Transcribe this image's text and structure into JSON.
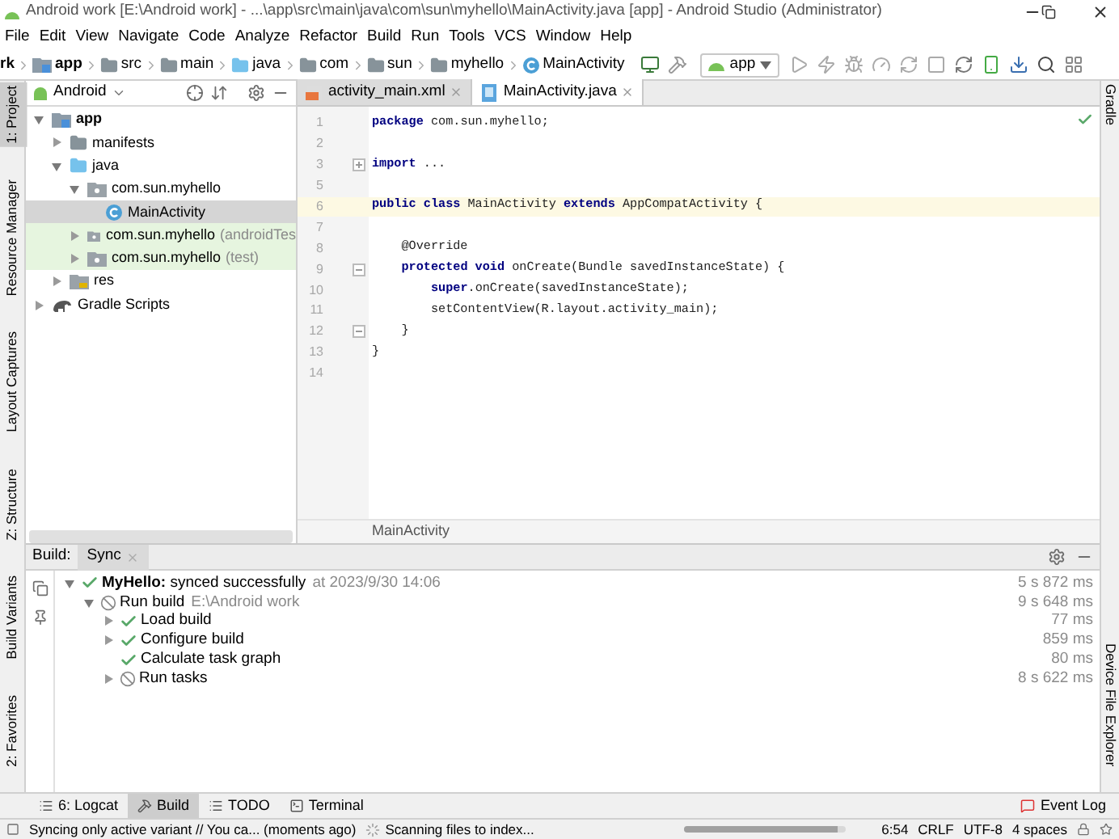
{
  "window": {
    "title": "Android work [E:\\Android work] - ...\\app\\src\\main\\java\\com\\sun\\myhello\\MainActivity.java [app] - Android Studio (Administrator)"
  },
  "menu": [
    "File",
    "Edit",
    "View",
    "Navigate",
    "Code",
    "Analyze",
    "Refactor",
    "Build",
    "Run",
    "Tools",
    "VCS",
    "Window",
    "Help"
  ],
  "breadcrumbs": [
    {
      "label": "rk",
      "kind": "text"
    },
    {
      "label": "app",
      "kind": "module"
    },
    {
      "label": "src",
      "kind": "folder"
    },
    {
      "label": "main",
      "kind": "folder"
    },
    {
      "label": "java",
      "kind": "source"
    },
    {
      "label": "com",
      "kind": "folder"
    },
    {
      "label": "sun",
      "kind": "folder"
    },
    {
      "label": "myhello",
      "kind": "folder"
    },
    {
      "label": "MainActivity",
      "kind": "class"
    }
  ],
  "run_config": "app",
  "left_tools": [
    {
      "label": "1: Project",
      "selected": true
    },
    {
      "label": "Resource Manager",
      "selected": false
    },
    {
      "label": "Layout Captures",
      "selected": false
    },
    {
      "label": "Z: Structure",
      "selected": false
    },
    {
      "label": "Build Variants",
      "selected": false
    },
    {
      "label": "2: Favorites",
      "selected": false
    }
  ],
  "right_tools": [
    "Gradle",
    "Device File Explorer"
  ],
  "project": {
    "view": "Android",
    "tree": [
      {
        "label": "app",
        "kind": "module",
        "expanded": true,
        "children": [
          {
            "label": "manifests",
            "kind": "folder",
            "expanded": false
          },
          {
            "label": "java",
            "kind": "source",
            "expanded": true,
            "children": [
              {
                "label": "com.sun.myhello",
                "kind": "package",
                "expanded": true,
                "children": [
                  {
                    "label": "MainActivity",
                    "kind": "class",
                    "selected": true
                  }
                ]
              },
              {
                "label": "com.sun.myhello",
                "suffix": "(androidTes",
                "kind": "package",
                "expanded": false,
                "test": true
              },
              {
                "label": "com.sun.myhello",
                "suffix": "(test)",
                "kind": "package",
                "expanded": false,
                "test": true
              }
            ]
          },
          {
            "label": "res",
            "kind": "res",
            "expanded": false
          }
        ]
      },
      {
        "label": "Gradle Scripts",
        "kind": "gradle",
        "expanded": false
      }
    ]
  },
  "editor": {
    "tabs": [
      {
        "label": "activity_main.xml",
        "kind": "xml",
        "selected": false
      },
      {
        "label": "MainActivity.java",
        "kind": "java",
        "selected": true
      }
    ],
    "lines": [
      {
        "number": "1",
        "text": "**package** com.sun.myhello;",
        "current": false
      },
      {
        "number": "2",
        "current": false
      },
      {
        "number": "3",
        "text": "**import** ...",
        "current": false,
        "folded": true
      },
      {
        "number": "5",
        "current": false
      },
      {
        "number": "6",
        "text": "**public class** MainActivity **extends** AppCompatActivity {",
        "current": true
      },
      {
        "number": "7",
        "current": false
      },
      {
        "number": "8",
        "text": "    @Override",
        "current": false
      },
      {
        "number": "9",
        "text": "    **protected void** onCreate(Bundle savedInstanceState) {",
        "current": false,
        "folded": false
      },
      {
        "number": "10",
        "text": "        **super**.onCreate(savedInstanceState);",
        "current": false
      },
      {
        "number": "11",
        "text": "        setContentView(R.layout.activity_main);",
        "current": false
      },
      {
        "number": "12",
        "text": "    }",
        "current": false,
        "folded": false
      },
      {
        "number": "13",
        "text": "}",
        "current": false
      },
      {
        "number": "14",
        "current": false
      }
    ],
    "breadcrumb": "MainActivity"
  },
  "build": {
    "label": "Build:",
    "tabs": [
      {
        "label": "Sync",
        "selected": true
      }
    ],
    "tree": [
      {
        "label": "**MyHello:** synced successfully",
        "detail": "at 2023/9/30 14:06",
        "cancelled": false,
        "time": "5 s 872 ms",
        "expanded": true,
        "children": [
          {
            "label": "Run build",
            "detail": "E:\\Android work",
            "cancelled": true,
            "time": "9 s 648 ms",
            "expanded": true,
            "children": [
              {
                "label": "Load build",
                "cancelled": false,
                "time": "77 ms",
                "expanded": false
              },
              {
                "label": "Configure build",
                "cancelled": false,
                "time": "859 ms",
                "expanded": false
              },
              {
                "label": "Calculate task graph",
                "cancelled": false,
                "time": "80 ms"
              },
              {
                "label": "Run tasks",
                "cancelled": true,
                "time": "8 s 622 ms",
                "expanded": false
              }
            ]
          }
        ]
      }
    ]
  },
  "bottom_tabs": [
    {
      "label": "6: Logcat",
      "kind": "list",
      "selected": false
    },
    {
      "label": "Build",
      "kind": "hammer",
      "selected": true
    },
    {
      "label": "TODO",
      "kind": "list",
      "selected": false
    },
    {
      "label": "Terminal",
      "kind": "terminal",
      "selected": false
    }
  ],
  "event_log": "Event Log",
  "status_bar": {
    "message": "Syncing only active variant // You ca... (moments ago)",
    "task": "Scanning files to index...",
    "level": 0.95,
    "position": "6:54",
    "line_separator": "CRLF",
    "encoding": "UTF-8",
    "indent": "4 spaces"
  }
}
